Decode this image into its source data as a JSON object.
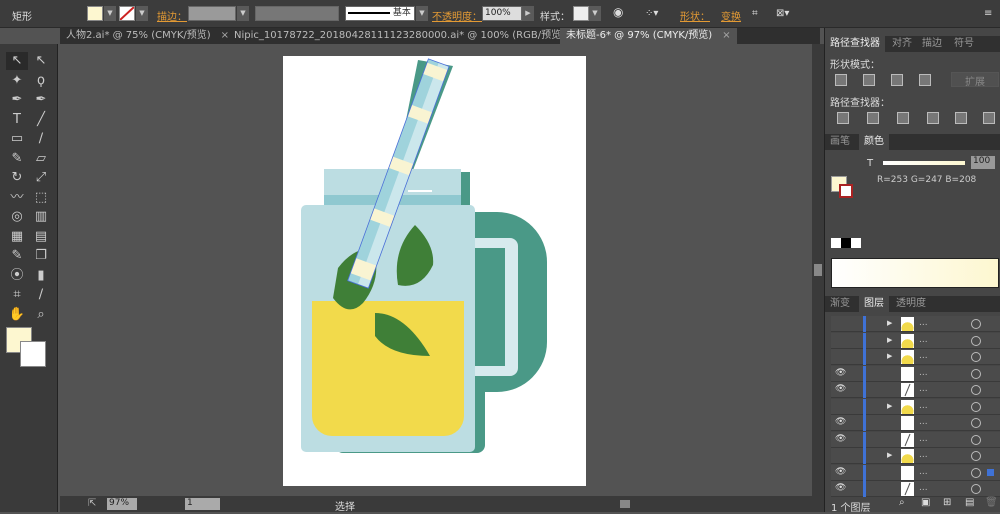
{
  "control_bar": {
    "tool_name": "矩形",
    "stroke_label": "描边：",
    "stroke_profile": "基本",
    "opacity_label": "不透明度：",
    "opacity_value": "100%",
    "style_label": "样式：",
    "shape_label": "形状：",
    "transform_label": "变换",
    "fill_color": "#fdf7d0"
  },
  "doc_tabs": [
    {
      "label": "人物2.ai* @ 75% (CMYK/预览)",
      "active": false
    },
    {
      "label": "Nipic_10178722_20180428111123280000.ai* @ 100% (RGB/预览)",
      "active": false
    },
    {
      "label": "未标题-6* @ 97% (CMYK/预览)",
      "active": true
    }
  ],
  "tools": [
    "selection-tool",
    "direct-selection-tool",
    "magic-wand-tool",
    "lasso-tool",
    "pen-tool",
    "curvature-tool",
    "type-tool",
    "line-tool",
    "rectangle-tool",
    "paintbrush-tool",
    "pencil-tool",
    "eraser-tool",
    "rotate-tool",
    "scale-tool",
    "warp-tool",
    "free-transform-tool",
    "shape-builder-tool",
    "perspective-grid-tool",
    "mesh-tool",
    "gradient-tool",
    "eyedropper-tool",
    "blend-tool",
    "symbol-sprayer-tool",
    "column-graph-tool",
    "artboard-tool",
    "slice-tool",
    "hand-tool",
    "zoom-tool"
  ],
  "pathfinder": {
    "tabs": [
      "路径查找器",
      "对齐",
      "描边",
      "符号"
    ],
    "shape_modes_label": "形状模式：",
    "expand_label": "扩展",
    "pathfinders_label": "路径查找器："
  },
  "color_panel": {
    "tabs": [
      "画笔",
      "颜色"
    ],
    "tint_label": "T",
    "tint_value": "100",
    "rgb_readout": "R=253 G=247 B=208",
    "fill_color": "#fdf7d0"
  },
  "layers_panel": {
    "tabs": [
      "渐变",
      "图层",
      "透明度"
    ],
    "footer_label": "1 个图层",
    "rows": [
      {
        "visible": false,
        "expand": true,
        "thumb": "lemon",
        "name": "..."
      },
      {
        "visible": false,
        "expand": true,
        "thumb": "lemon",
        "name": "..."
      },
      {
        "visible": false,
        "expand": true,
        "thumb": "lemon",
        "name": "..."
      },
      {
        "visible": true,
        "expand": false,
        "thumb": "blank",
        "name": "..."
      },
      {
        "visible": true,
        "expand": false,
        "thumb": "line",
        "name": "..."
      },
      {
        "visible": false,
        "expand": true,
        "thumb": "lemon",
        "name": "..."
      },
      {
        "visible": true,
        "expand": false,
        "thumb": "blank",
        "name": "..."
      },
      {
        "visible": true,
        "expand": false,
        "thumb": "line",
        "name": "..."
      },
      {
        "visible": false,
        "expand": true,
        "thumb": "lemon",
        "name": "..."
      },
      {
        "visible": true,
        "expand": false,
        "thumb": "blank",
        "name": "...",
        "selected": true
      },
      {
        "visible": true,
        "expand": false,
        "thumb": "line",
        "name": "..."
      }
    ]
  },
  "status_bar": {
    "zoom": "97%",
    "page": "1",
    "mode": "选择"
  },
  "artwork_colors": {
    "jar": "#bcdde2",
    "lid_band": "#8fc8d0",
    "shadow": "#4a9987",
    "juice": "#f2da4b",
    "leaf": "#3f7f37",
    "straw": "#9fd3dc",
    "straw_stripe": "#f9f4d2"
  }
}
